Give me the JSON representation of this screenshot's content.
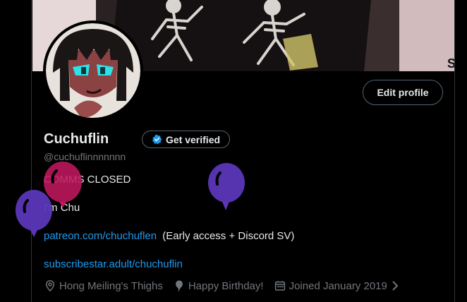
{
  "profile": {
    "edit_label": "Edit profile",
    "name": "Cuchuflin",
    "verify_label": "Get verified",
    "handle": "@cuchuflinnnnnnn"
  },
  "bio": {
    "line1": "COMMS CLOSED",
    "line2": "I'm Chu",
    "link1": "patreon.com/chuchuflen",
    "link1_suffix": "(Early access + Discord SV)",
    "link2": "subscribestar.adult/chuchuflin"
  },
  "meta": {
    "location": "Hong Meiling's Thighs",
    "birthday": "Happy Birthday!",
    "joined": "Joined January 2019"
  },
  "colors": {
    "accent": "#1d9bf0",
    "balloon_pink": "#c0185f",
    "balloon_purple": "#5b36b8"
  },
  "icons": [
    "verified-badge-icon",
    "location-icon",
    "balloon-icon",
    "calendar-icon",
    "chevron-right-icon"
  ]
}
